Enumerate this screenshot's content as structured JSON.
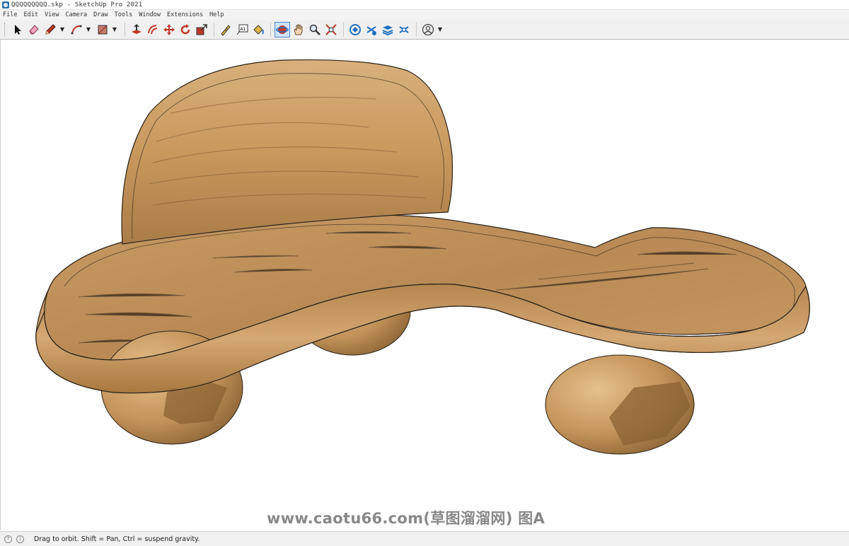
{
  "window": {
    "title": "QQQQQQQQQ.skp - SketchUp Pro 2021"
  },
  "menu": {
    "items": [
      "File",
      "Edit",
      "View",
      "Camera",
      "Draw",
      "Tools",
      "Window",
      "Extensions",
      "Help"
    ]
  },
  "toolbar": {
    "tools": [
      {
        "name": "select-tool",
        "icon": "cursor-arrow-icon"
      },
      {
        "name": "eraser-tool",
        "icon": "eraser-icon"
      },
      {
        "name": "line-tool",
        "icon": "pencil-icon"
      },
      {
        "name": "arc-tool",
        "icon": "arc-icon"
      },
      {
        "name": "shape-tool",
        "icon": "rectangle-icon"
      },
      {
        "name": "push-pull-tool",
        "icon": "push-pull-icon"
      },
      {
        "name": "offset-tool",
        "icon": "offset-icon"
      },
      {
        "name": "move-tool",
        "icon": "move-icon"
      },
      {
        "name": "rotate-tool",
        "icon": "rotate-icon"
      },
      {
        "name": "scale-tool",
        "icon": "scale-icon"
      },
      {
        "name": "tape-measure-tool",
        "icon": "tape-measure-icon"
      },
      {
        "name": "text-tool",
        "icon": "text-icon"
      },
      {
        "name": "paint-bucket-tool",
        "icon": "paint-bucket-icon"
      },
      {
        "name": "orbit-tool",
        "icon": "orbit-icon",
        "active": true
      },
      {
        "name": "pan-tool",
        "icon": "hand-icon"
      },
      {
        "name": "zoom-tool",
        "icon": "magnifier-icon"
      },
      {
        "name": "zoom-extents-tool",
        "icon": "zoom-extents-icon"
      },
      {
        "name": "warehouse-tool",
        "icon": "warehouse-icon"
      },
      {
        "name": "extension-warehouse-tool",
        "icon": "extension-warehouse-icon"
      },
      {
        "name": "layout-tool",
        "icon": "layout-icon"
      },
      {
        "name": "extension-manager-tool",
        "icon": "extension-manager-icon"
      },
      {
        "name": "account-tool",
        "icon": "user-icon"
      }
    ],
    "text_tool_label": "A1"
  },
  "watermark": "www.caotu66.com(草图溜溜网) 图A",
  "status": {
    "text": "Drag to orbit. Shift = Pan, Ctrl = suspend gravity."
  },
  "colors": {
    "accent": "#4a8ad8",
    "wood": "#c99a62",
    "wood_dark": "#a87a44",
    "outline": "#2b2218"
  }
}
